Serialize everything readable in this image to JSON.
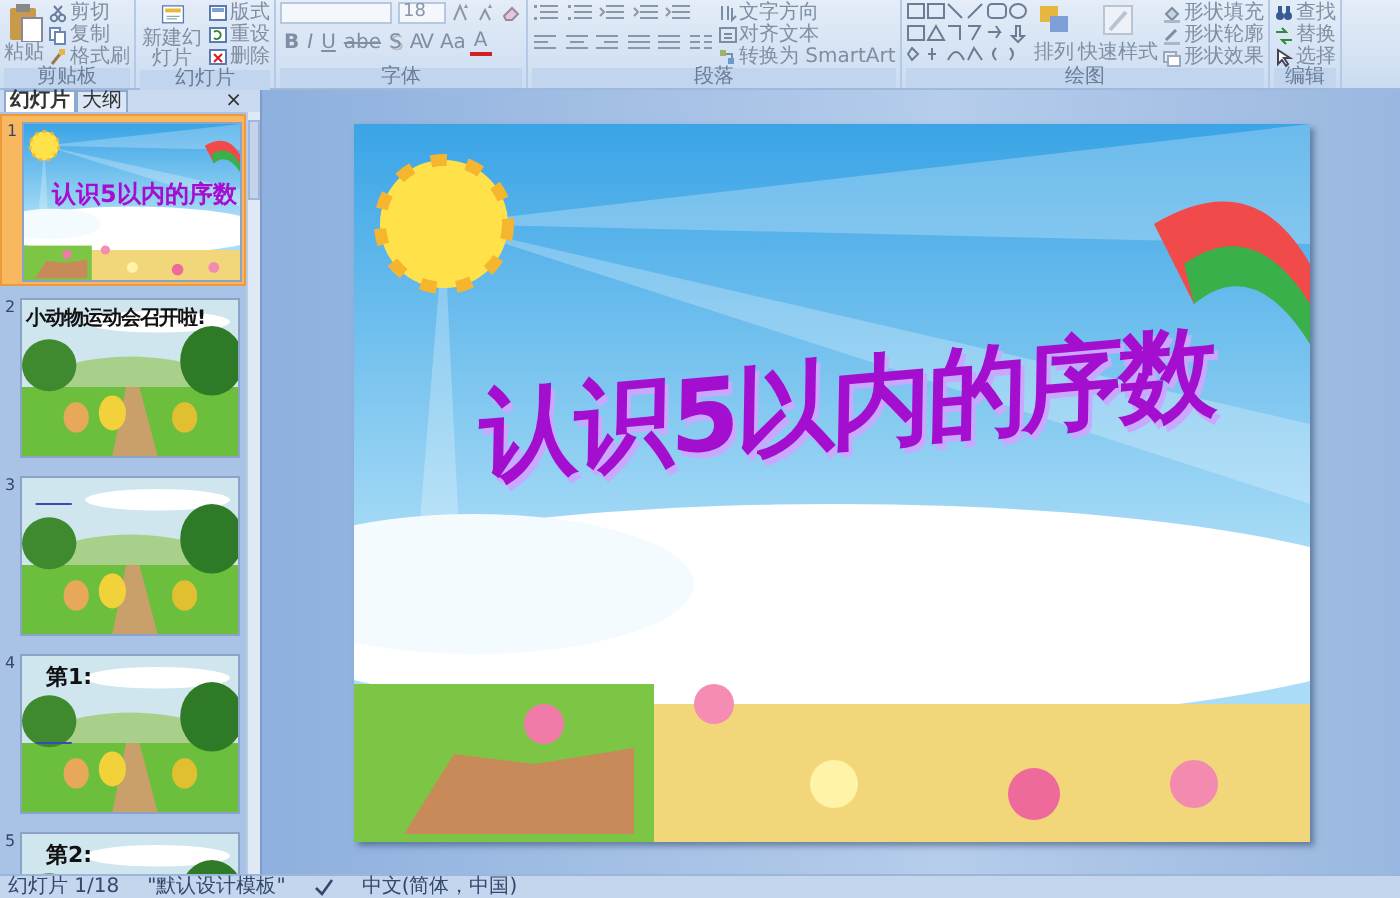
{
  "ribbon": {
    "groups": [
      {
        "kind": "clipboard",
        "label": "剪贴板",
        "large": [
          "粘贴"
        ],
        "small": [
          "剪切",
          "复制",
          "格式刷"
        ]
      },
      {
        "kind": "slides",
        "label": "幻灯片",
        "large": [
          "新建幻灯片"
        ],
        "small": [
          "版式",
          "重设",
          "删除"
        ]
      },
      {
        "kind": "font",
        "label": "字体",
        "font_size": "18",
        "format_buttons": [
          "B",
          "I",
          "U",
          "abe",
          "S",
          "AV",
          "Aa",
          "A"
        ]
      },
      {
        "kind": "paragraph",
        "label": "段落",
        "small": [
          "文字方向",
          "对齐文本",
          "转换为 SmartArt"
        ]
      },
      {
        "kind": "drawing",
        "label": "绘图",
        "large": [
          "排列",
          "快速样式"
        ],
        "small": [
          "形状填充",
          "形状轮廓",
          "形状效果"
        ]
      },
      {
        "kind": "editing",
        "label": "编辑",
        "small": [
          "查找",
          "替换",
          "选择"
        ]
      }
    ]
  },
  "panel": {
    "tabs": [
      {
        "label": "幻灯片",
        "selected": true
      },
      {
        "label": "大纲",
        "selected": false
      }
    ],
    "close": "×",
    "slides": [
      {
        "number": "1",
        "kind": "cover",
        "selected": true,
        "title": "认识5以内的序数"
      },
      {
        "number": "2",
        "kind": "heading",
        "selected": false,
        "title": "小动物运动会召开啦!"
      },
      {
        "number": "3",
        "kind": "plain",
        "selected": false
      },
      {
        "number": "4",
        "kind": "numbered",
        "selected": false,
        "title": "第1:"
      },
      {
        "number": "5",
        "kind": "numbered",
        "selected": false,
        "title": "第2:"
      }
    ]
  },
  "slide": {
    "title": "认识5以内的序数"
  },
  "status_bar": {
    "slide_count": "幻灯片 1/18",
    "theme": "\"默认设计模板\"",
    "language": "中文(简体，中国)"
  }
}
